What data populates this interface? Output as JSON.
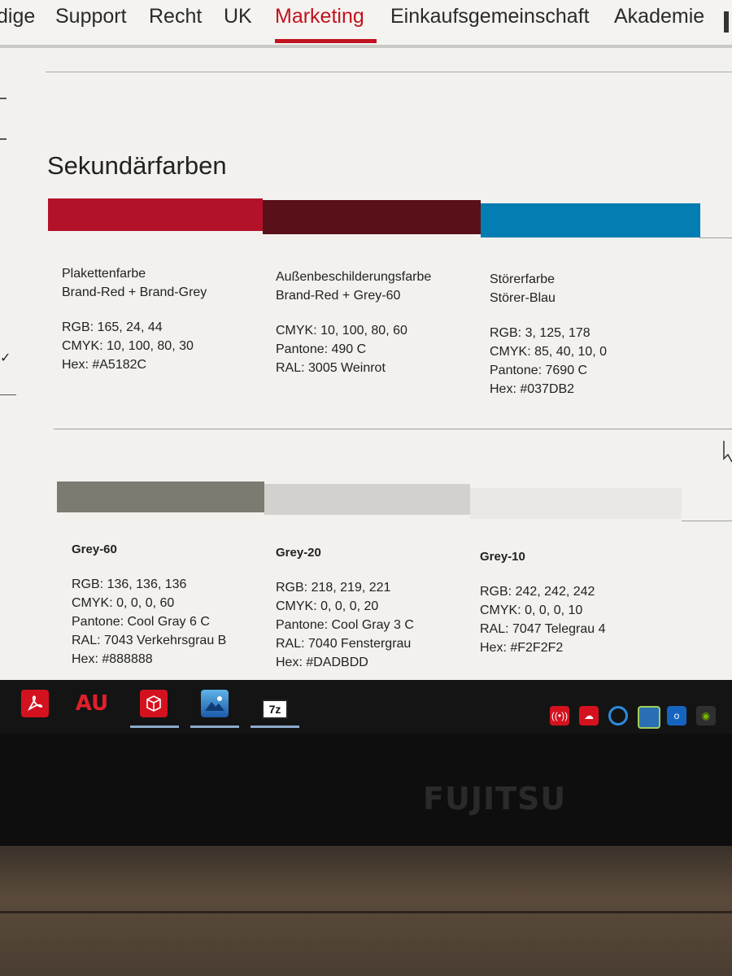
{
  "nav": {
    "items": [
      "dige",
      "Support",
      "Recht",
      "UK",
      "Marketing",
      "Einkaufsgemeinschaft",
      "Akademie"
    ],
    "active": "Marketing"
  },
  "section_title": "Sekundärfarben",
  "primary_colors": [
    {
      "title": "Plakettenfarbe",
      "subtitle": "Brand-Red + Brand-Grey",
      "color": "#A5182C",
      "lines": [
        "RGB: 165, 24, 44",
        "CMYK: 10, 100, 80, 30",
        "Hex: #A5182C"
      ]
    },
    {
      "title": "Außenbeschilderungsfarbe",
      "subtitle": "Brand-Red + Grey-60",
      "color": "#5a1018",
      "lines": [
        "CMYK: 10, 100, 80, 60",
        "Pantone: 490 C",
        "RAL: 3005 Weinrot"
      ]
    },
    {
      "title": "Störerfarbe",
      "subtitle": "Störer-Blau",
      "color": "#037DB2",
      "lines": [
        "RGB: 3, 125, 178",
        "CMYK: 85, 40, 10, 0",
        "Pantone: 7690 C",
        "Hex: #037DB2"
      ]
    }
  ],
  "grey_colors": [
    {
      "title": "Grey-60",
      "color": "#888888",
      "lines": [
        "RGB: 136, 136, 136",
        "CMYK: 0, 0, 0, 60",
        "Pantone: Cool Gray 6 C",
        "RAL: 7043 Verkehrsgrau B",
        "Hex: #888888"
      ]
    },
    {
      "title": "Grey-20",
      "color": "#DADBDD",
      "lines": [
        "RGB: 218, 219, 221",
        "CMYK: 0, 0, 0, 20",
        "Pantone: Cool Gray 3 C",
        "RAL: 7040 Fenstergrau",
        "Hex: #DADBDD"
      ]
    },
    {
      "title": "Grey-10",
      "color": "#F2F2F2",
      "lines": [
        "RGB: 242, 242, 242",
        "CMYK: 0, 0, 0, 10",
        "RAL: 7047 Telegrau 4",
        "Hex: #F2F2F2"
      ]
    }
  ],
  "taskbar": {
    "apps": [
      "acrobat-icon",
      "au-icon",
      "package-icon",
      "photos-icon",
      "7zip-icon"
    ],
    "app_labels": [
      "AU",
      "7z"
    ],
    "tray": [
      "broadcast-icon",
      "cloud-sync-icon",
      "browser-icon",
      "monitor-icon",
      "outlook-icon",
      "nvidia-icon"
    ]
  },
  "bezel": {
    "brand": "FUJITSU"
  }
}
